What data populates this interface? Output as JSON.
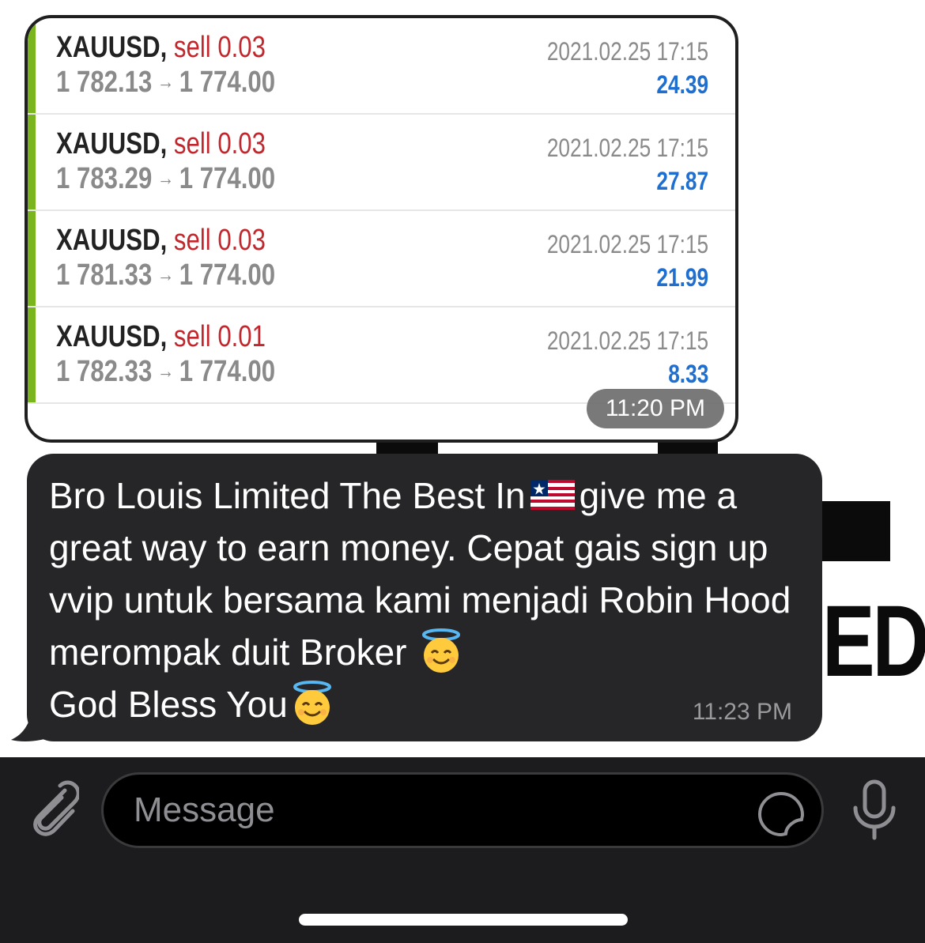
{
  "trades": [
    {
      "symbol": "XAUUSD",
      "side": "sell 0.03",
      "open_price": "1 782.13",
      "close_price": "1 774.00",
      "date": "2021.02.25 17:15",
      "profit": "24.39"
    },
    {
      "symbol": "XAUUSD",
      "side": "sell 0.03",
      "open_price": "1 783.29",
      "close_price": "1 774.00",
      "date": "2021.02.25 17:15",
      "profit": "27.87"
    },
    {
      "symbol": "XAUUSD",
      "side": "sell 0.03",
      "open_price": "1 781.33",
      "close_price": "1 774.00",
      "date": "2021.02.25 17:15",
      "profit": "21.99"
    },
    {
      "symbol": "XAUUSD",
      "side": "sell 0.01",
      "open_price": "1 782.33",
      "close_price": "1 774.00",
      "date": "2021.02.25 17:15",
      "profit": "8.33"
    }
  ],
  "image_message": {
    "time": "11:20 PM"
  },
  "text_message": {
    "part1": "Bro Louis Limited The Best In",
    "flag_emoji": "liberia-flag",
    "part2": "give me a great way to earn money. Cepat gais sign up vvip untuk bersama kami menjadi Robin Hood merompak duit Broker",
    "angel_emoji": "smiling-face-with-halo",
    "part3": "God Bless You",
    "time": "11:23 PM"
  },
  "background": {
    "letters": "ED"
  },
  "composer": {
    "placeholder": "Message",
    "attach_icon": "paperclip-icon",
    "sticker_icon": "sticker-icon",
    "mic_icon": "microphone-icon"
  },
  "colors": {
    "sell": "#c2272d",
    "profit": "#1e6fcf",
    "accent_bar": "#7ab51d",
    "bubble": "#262628",
    "input_bar": "#1c1c1e"
  }
}
